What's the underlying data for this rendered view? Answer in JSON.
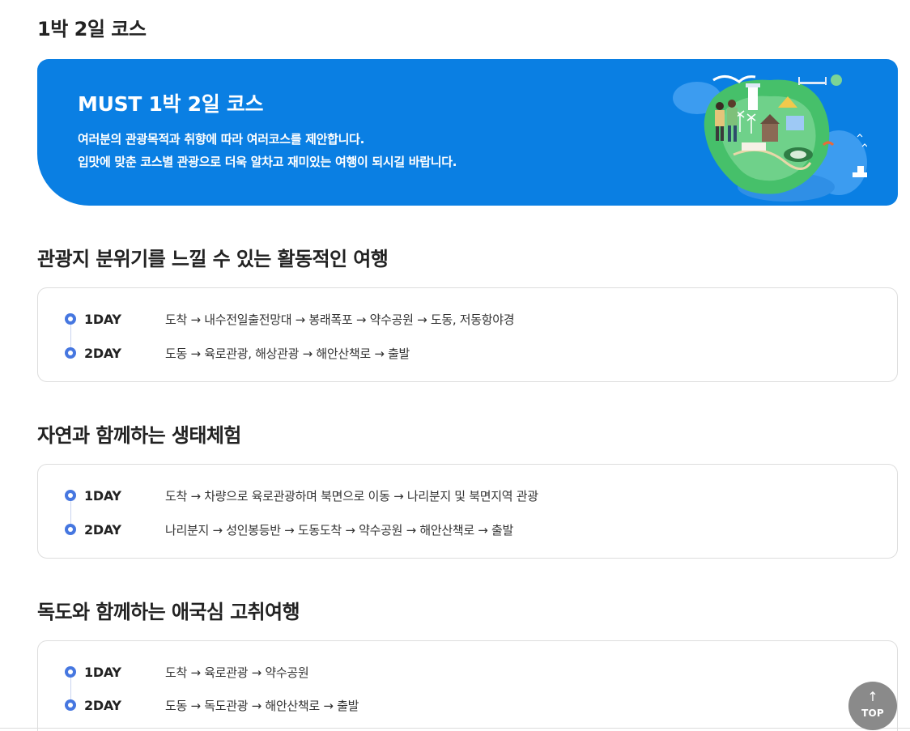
{
  "page_title": "1박 2일 코스",
  "banner": {
    "title": "MUST 1박 2일 코스",
    "desc_line1": "여러분의 관광목적과 취향에 따라 여러코스를 제안합니다.",
    "desc_line2": "입맛에 맞춘 코스별 관광으로 더욱 알차고 재미있는 여행이 되시길 바랍니다.",
    "background_color": "#0a7fe3",
    "illustration": "ulleungdo-island-illustration"
  },
  "courses": [
    {
      "title": "관광지 분위기를 느낄 수 있는 활동적인 여행",
      "days": [
        {
          "label": "1DAY",
          "route": "도착 → 내수전일출전망대 → 봉래폭포 → 약수공원 → 도동, 저동항야경"
        },
        {
          "label": "2DAY",
          "route": "도동 → 육로관광, 해상관광 → 해안산책로 → 출발"
        }
      ]
    },
    {
      "title": "자연과 함께하는 생태체험",
      "days": [
        {
          "label": "1DAY",
          "route": "도착 → 차량으로 육로관광하며 북면으로 이동 → 나리분지 및 북면지역 관광"
        },
        {
          "label": "2DAY",
          "route": "나리분지 → 성인봉등반 → 도동도착 → 약수공원 → 해안산책로 → 출발"
        }
      ]
    },
    {
      "title": "독도와 함께하는 애국심 고취여행",
      "days": [
        {
          "label": "1DAY",
          "route": "도착 → 육로관광 → 약수공원"
        },
        {
          "label": "2DAY",
          "route": "도동 → 독도관광 → 해안산책로 → 출발"
        }
      ]
    }
  ],
  "top_button": {
    "arrow": "↑",
    "label": "TOP"
  },
  "colors": {
    "accent": "#4677e0",
    "banner": "#0a7fe3"
  }
}
